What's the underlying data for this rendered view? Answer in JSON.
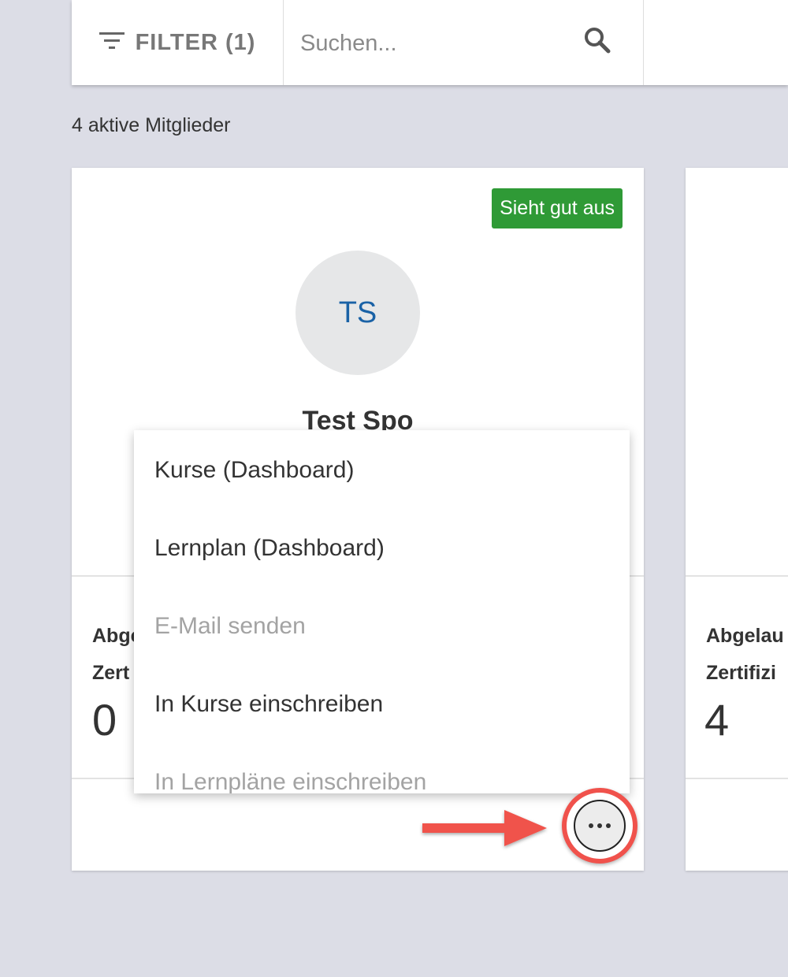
{
  "toolbar": {
    "filter_label": "FILTER (1)",
    "filter_icon": "filter-lines-icon",
    "search_placeholder": "Suchen...",
    "search_icon": "search-icon"
  },
  "member_count": "4 aktive Mitglieder",
  "cards": [
    {
      "badge": "Sieht gut aus",
      "badge_color": "#2f9a36",
      "initials": "TS",
      "name": "Test Spo",
      "stat_label_1": "Abge",
      "stat_label_2": "Zert",
      "stat_value": "0"
    },
    {
      "stat_label_1": "Abgelau",
      "stat_label_2": "Zertifizi",
      "stat_value": "4"
    }
  ],
  "menu": {
    "items": [
      {
        "label": "Kurse (Dashboard)",
        "enabled": true
      },
      {
        "label": "Lernplan (Dashboard)",
        "enabled": true
      },
      {
        "label": "E-Mail senden",
        "enabled": false
      },
      {
        "label": "In Kurse einschreiben",
        "enabled": true
      },
      {
        "label": "In Lernpläne einschreiben",
        "enabled": false
      }
    ]
  },
  "more_button": {
    "icon": "more-horizontal-icon",
    "highlight_color": "#f0524c"
  },
  "annotation": {
    "icon": "arrow-right-icon",
    "color": "#f0524c"
  }
}
